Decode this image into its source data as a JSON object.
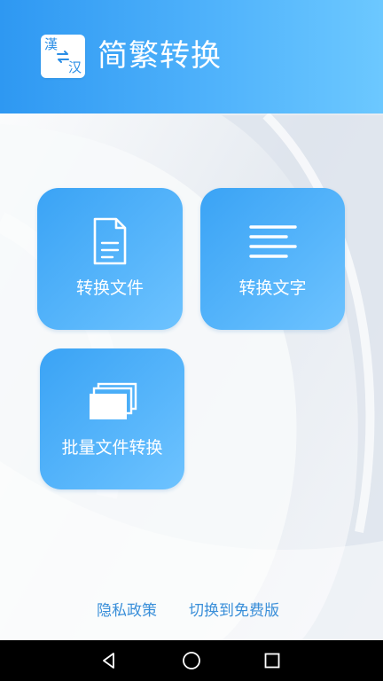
{
  "app": {
    "title": "简繁转换",
    "logo_top_char": "漢",
    "logo_bottom_char": "汉"
  },
  "tiles": [
    {
      "label": "转换文件",
      "icon": "document-icon"
    },
    {
      "label": "转换文字",
      "icon": "text-lines-icon"
    },
    {
      "label": "批量文件转换",
      "icon": "stacked-files-icon"
    }
  ],
  "footer": {
    "privacy_label": "隐私政策",
    "free_version_label": "切换到免费版"
  },
  "system_nav": {
    "back_icon": "back-triangle-icon",
    "home_icon": "home-circle-icon",
    "recents_icon": "recents-square-icon"
  },
  "colors": {
    "header_start": "#2e98f2",
    "header_end": "#6cc8ff",
    "tile": "#4aaef8",
    "link": "#3a8fd9",
    "navbar": "#000000"
  }
}
